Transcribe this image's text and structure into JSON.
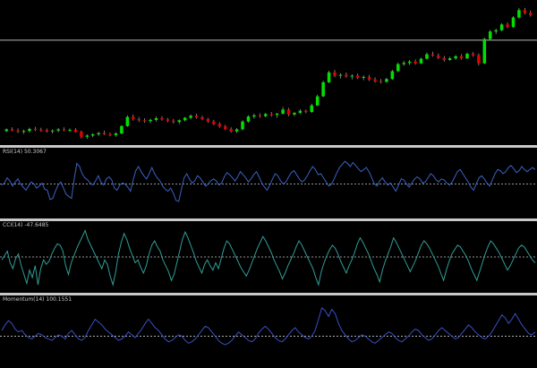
{
  "colors": {
    "background": "#000000",
    "separator": "#c8c8c8",
    "bull_candle": "#00e000",
    "bear_candle": "#e00000",
    "wick": "#b0b0b0",
    "rsi_line": "#3a62c4",
    "cci_line": "#2f9d96",
    "momentum_line": "#3a4fc4",
    "level_line": "#c8c8c8",
    "hline": "#b8b8b8"
  },
  "price": {
    "hline_level": 122,
    "candles": [
      [
        100,
        100.6,
        99.7,
        100.4
      ],
      [
        100.4,
        100.9,
        99.9,
        100.1
      ],
      [
        100.1,
        100.6,
        99.5,
        99.8
      ],
      [
        99.8,
        100.3,
        99.3,
        100
      ],
      [
        100,
        100.8,
        99.6,
        100.5
      ],
      [
        100.5,
        101,
        100,
        100.3
      ],
      [
        100.3,
        100.8,
        99.8,
        100.2
      ],
      [
        100.2,
        100.6,
        99.6,
        99.9
      ],
      [
        99.9,
        100.4,
        99.4,
        100.1
      ],
      [
        100.1,
        100.7,
        99.7,
        100.4
      ],
      [
        100.4,
        100.9,
        99.9,
        100.2
      ],
      [
        100.2,
        100.6,
        99.8,
        100.3
      ],
      [
        100.3,
        100.7,
        99.6,
        99.8
      ],
      [
        99.8,
        100.1,
        98.2,
        98.6
      ],
      [
        98.6,
        99.2,
        98.1,
        98.9
      ],
      [
        98.9,
        99.5,
        98.5,
        99.2
      ],
      [
        99.2,
        99.8,
        98.8,
        99.5
      ],
      [
        99.5,
        100.1,
        99,
        99.2
      ],
      [
        99.2,
        99.6,
        98.7,
        99
      ],
      [
        99,
        99.7,
        98.6,
        99.4
      ],
      [
        99.4,
        101.4,
        99.2,
        101.2
      ],
      [
        101.2,
        103.8,
        101,
        103.4
      ],
      [
        103.4,
        104,
        102.5,
        102.9
      ],
      [
        102.9,
        103.4,
        102.2,
        102.6
      ],
      [
        102.6,
        103.1,
        102,
        102.4
      ],
      [
        102.4,
        103,
        101.9,
        102.7
      ],
      [
        102.7,
        103.5,
        102.3,
        103.1
      ],
      [
        103.1,
        103.6,
        102.5,
        102.8
      ],
      [
        102.8,
        103.2,
        102.1,
        102.5
      ],
      [
        102.5,
        102.9,
        101.8,
        102.2
      ],
      [
        102.2,
        102.8,
        101.7,
        102.6
      ],
      [
        102.6,
        103.4,
        102.3,
        103.2
      ],
      [
        103.2,
        104,
        102.8,
        103.7
      ],
      [
        103.7,
        104.2,
        103,
        103.3
      ],
      [
        103.3,
        103.7,
        102.6,
        102.9
      ],
      [
        102.9,
        103.2,
        102,
        102.3
      ],
      [
        102.3,
        102.7,
        101.4,
        101.7
      ],
      [
        101.7,
        102.1,
        100.8,
        101.1
      ],
      [
        101.1,
        101.5,
        100.2,
        100.5
      ],
      [
        100.5,
        100.9,
        99.6,
        99.9
      ],
      [
        99.9,
        100.7,
        99.5,
        100.4
      ],
      [
        100.4,
        102.6,
        100.2,
        102.3
      ],
      [
        102.3,
        103.8,
        102,
        103.5
      ],
      [
        103.5,
        104.2,
        103,
        103.8
      ],
      [
        103.8,
        104.3,
        103.2,
        103.6
      ],
      [
        103.6,
        104.4,
        103.3,
        104.1
      ],
      [
        104.1,
        104.6,
        103.5,
        103.9
      ],
      [
        103.9,
        104.4,
        103.2,
        104.2
      ],
      [
        104.2,
        105.8,
        104,
        105.2
      ],
      [
        105.2,
        105.6,
        103.6,
        104
      ],
      [
        104,
        104.6,
        103.6,
        104.4
      ],
      [
        104.4,
        105.3,
        104.1,
        104.9
      ],
      [
        104.9,
        105.2,
        104.3,
        104.6
      ],
      [
        104.6,
        106.6,
        104.4,
        106.2
      ],
      [
        106.2,
        108.8,
        106,
        108.4
      ],
      [
        108.4,
        112.2,
        108.2,
        111.8
      ],
      [
        111.8,
        114.6,
        111.6,
        114.2
      ],
      [
        114.2,
        114.8,
        113,
        113.4
      ],
      [
        113.4,
        114,
        112.7,
        113.6
      ],
      [
        113.6,
        114.2,
        112.9,
        113.2
      ],
      [
        113.2,
        113.8,
        112.5,
        113.4
      ],
      [
        113.4,
        113.9,
        112.6,
        112.9
      ],
      [
        112.9,
        113.5,
        112.3,
        113.1
      ],
      [
        113.1,
        113.6,
        112.1,
        112.5
      ],
      [
        112.5,
        113,
        111.7,
        112.1
      ],
      [
        112.1,
        112.6,
        111.5,
        111.9
      ],
      [
        111.9,
        112.9,
        111.7,
        112.6
      ],
      [
        112.6,
        114.8,
        112.4,
        114.5
      ],
      [
        114.5,
        116.6,
        114.3,
        116.2
      ],
      [
        116.2,
        117,
        115.8,
        116.5
      ],
      [
        116.5,
        117.2,
        116,
        116.8
      ],
      [
        116.8,
        117.3,
        116.1,
        116.4
      ],
      [
        116.4,
        117.8,
        116.2,
        117.5
      ],
      [
        117.5,
        119,
        117.3,
        118.6
      ],
      [
        118.6,
        119.2,
        118,
        118.3
      ],
      [
        118.3,
        118.8,
        117.4,
        117.7
      ],
      [
        117.7,
        118.2,
        116.8,
        117.2
      ],
      [
        117.2,
        118,
        117,
        117.6
      ],
      [
        117.6,
        118.4,
        117.2,
        118.1
      ],
      [
        118.1,
        118.6,
        117.3,
        117.6
      ],
      [
        117.6,
        119,
        117.4,
        118.7
      ],
      [
        118.7,
        119.1,
        118,
        118.4
      ],
      [
        118.4,
        118.8,
        115.9,
        116.4
      ],
      [
        116.4,
        122.6,
        116.2,
        122.3
      ],
      [
        122.3,
        124.5,
        122,
        124.1
      ],
      [
        124.1,
        124.8,
        123.5,
        124.4
      ],
      [
        124.4,
        126.1,
        124.2,
        125.8
      ],
      [
        125.8,
        126.3,
        124.9,
        125.2
      ],
      [
        125.2,
        127.8,
        125,
        127.5
      ],
      [
        127.5,
        129.8,
        127.2,
        129.3
      ],
      [
        129.3,
        129.8,
        128.2,
        128.6
      ],
      [
        128.6,
        129.2,
        127.7,
        128.1
      ]
    ]
  },
  "rsi": {
    "label": "RSI(14) 50.3067",
    "level": 50,
    "ylim": [
      20,
      80
    ],
    "values": [
      49,
      51,
      56,
      53,
      48,
      52,
      55,
      50,
      47,
      44,
      48,
      52,
      50,
      46,
      48,
      51,
      45,
      44,
      35,
      36,
      43,
      49,
      52,
      46,
      40,
      38,
      36,
      55,
      70,
      67,
      60,
      56,
      54,
      51,
      49,
      53,
      58,
      52,
      49,
      55,
      57,
      54,
      46,
      44,
      49,
      51,
      50,
      47,
      43,
      54,
      63,
      67,
      62,
      58,
      55,
      60,
      66,
      60,
      56,
      53,
      48,
      45,
      43,
      46,
      41,
      34,
      33,
      45,
      56,
      60,
      55,
      51,
      53,
      58,
      56,
      52,
      48,
      50,
      53,
      55,
      53,
      49,
      51,
      57,
      61,
      59,
      56,
      53,
      57,
      62,
      59,
      56,
      52,
      55,
      59,
      62,
      57,
      51,
      47,
      44,
      49,
      55,
      60,
      58,
      53,
      50,
      52,
      57,
      61,
      63,
      59,
      55,
      52,
      54,
      58,
      63,
      67,
      64,
      59,
      60,
      56,
      52,
      48,
      50,
      55,
      61,
      66,
      69,
      72,
      70,
      67,
      71,
      68,
      65,
      62,
      64,
      66,
      62,
      56,
      50,
      48,
      53,
      56,
      52,
      49,
      51,
      47,
      43,
      49,
      55,
      54,
      50,
      47,
      51,
      55,
      57,
      55,
      51,
      52,
      56,
      60,
      58,
      54,
      52,
      55,
      54,
      51,
      49,
      52,
      57,
      62,
      64,
      60,
      56,
      52,
      47,
      44,
      50,
      56,
      58,
      55,
      51,
      48,
      54,
      60,
      64,
      63,
      60,
      62,
      66,
      68,
      65,
      61,
      63,
      67,
      64,
      62,
      64,
      66,
      64
    ]
  },
  "cci": {
    "label": "CCI(14) -47.6485",
    "level": 0,
    "ylim": [
      -220,
      220
    ],
    "values": [
      -20,
      10,
      40,
      -40,
      -80,
      -10,
      20,
      -60,
      -120,
      -180,
      -90,
      -140,
      -60,
      -190,
      -80,
      -20,
      -50,
      -30,
      20,
      60,
      90,
      80,
      40,
      -60,
      -120,
      -40,
      10,
      60,
      100,
      140,
      180,
      120,
      80,
      40,
      0,
      -40,
      -80,
      -20,
      -50,
      -130,
      -190,
      -100,
      20,
      100,
      160,
      120,
      60,
      10,
      -40,
      -20,
      -70,
      -110,
      -60,
      20,
      80,
      110,
      70,
      40,
      -20,
      -60,
      -100,
      -160,
      -120,
      -40,
      40,
      120,
      170,
      130,
      80,
      30,
      -30,
      -70,
      -110,
      -50,
      -20,
      -60,
      -90,
      -40,
      -80,
      -10,
      60,
      110,
      90,
      50,
      10,
      -30,
      -70,
      -100,
      -130,
      -90,
      -40,
      10,
      60,
      100,
      140,
      110,
      70,
      30,
      -20,
      -60,
      -100,
      -150,
      -110,
      -60,
      -20,
      20,
      70,
      110,
      80,
      40,
      0,
      -40,
      -80,
      -140,
      -190,
      -100,
      -40,
      10,
      50,
      80,
      60,
      20,
      -30,
      -70,
      -110,
      -60,
      -20,
      30,
      90,
      130,
      100,
      60,
      20,
      -30,
      -80,
      -120,
      -170,
      -90,
      -30,
      20,
      70,
      130,
      100,
      60,
      20,
      -20,
      -60,
      -100,
      -60,
      -20,
      30,
      80,
      110,
      90,
      60,
      20,
      -20,
      -60,
      -110,
      -160,
      -90,
      -30,
      20,
      50,
      80,
      70,
      40,
      10,
      -30,
      -80,
      -120,
      -160,
      -100,
      -40,
      20,
      70,
      110,
      90,
      60,
      30,
      -10,
      -50,
      -90,
      -60,
      -20,
      20,
      60,
      80,
      70,
      40,
      10,
      -20,
      -40
    ]
  },
  "momentum": {
    "label": "Momentum(14) 100.1551",
    "level": 100,
    "ylim": [
      98,
      102.5
    ],
    "values": [
      100.4,
      100.8,
      101.1,
      100.9,
      100.5,
      100.3,
      100.4,
      100.1,
      99.9,
      99.8,
      100.0,
      100.2,
      100.1,
      99.9,
      99.8,
      99.7,
      99.9,
      100.1,
      100.0,
      99.8,
      100.2,
      100.4,
      100.1,
      99.8,
      99.7,
      99.9,
      100.4,
      100.8,
      101.2,
      101.0,
      100.8,
      100.5,
      100.3,
      100.1,
      99.9,
      99.7,
      99.8,
      100.0,
      100.3,
      100.1,
      99.9,
      100.2,
      100.5,
      100.9,
      101.2,
      100.9,
      100.6,
      100.4,
      100.1,
      99.8,
      99.6,
      99.7,
      99.9,
      100.1,
      100.0,
      99.7,
      99.5,
      99.6,
      99.8,
      100.1,
      100.4,
      100.7,
      100.6,
      100.3,
      100.0,
      99.7,
      99.5,
      99.4,
      99.5,
      99.7,
      100.0,
      100.3,
      100.1,
      99.9,
      99.7,
      99.6,
      99.8,
      100.2,
      100.5,
      100.7,
      100.5,
      100.2,
      99.9,
      99.7,
      99.6,
      99.8,
      100.1,
      100.4,
      100.6,
      100.3,
      100.1,
      99.9,
      99.8,
      100.0,
      100.4,
      101.2,
      102.0,
      101.8,
      101.4,
      101.9,
      101.6,
      100.9,
      100.4,
      100.1,
      99.8,
      99.6,
      99.7,
      99.9,
      100.1,
      100.0,
      99.8,
      99.6,
      99.5,
      99.7,
      99.9,
      100.1,
      100.3,
      100.2,
      99.9,
      99.7,
      99.6,
      99.8,
      100.0,
      100.3,
      100.5,
      100.4,
      100.1,
      99.9,
      99.7,
      99.8,
      100.1,
      100.4,
      100.6,
      100.4,
      100.2,
      100.0,
      99.8,
      99.9,
      100.2,
      100.5,
      100.8,
      100.6,
      100.3,
      100.1,
      99.9,
      99.8,
      100.0,
      100.3,
      100.7,
      101.1,
      101.5,
      101.3,
      100.9,
      101.2,
      101.6,
      101.2,
      100.8,
      100.5,
      100.2,
      100.1,
      100.3
    ]
  }
}
